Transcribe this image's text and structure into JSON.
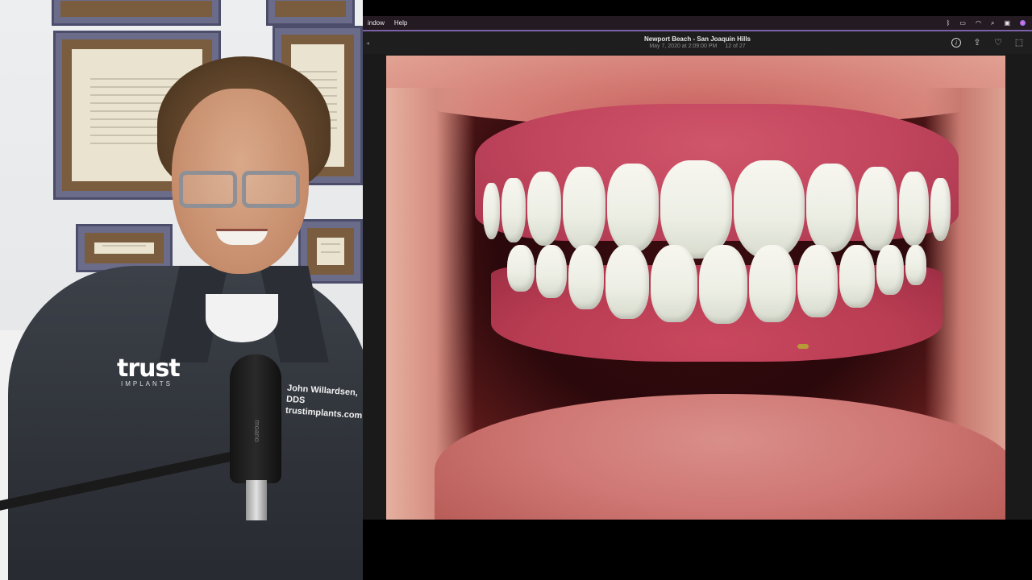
{
  "camera": {
    "logo_text": "trust",
    "logo_subtext": "IMPLANTS",
    "embroidery_line1": "John Willardsen, DDS",
    "embroidery_line2": "trustimplants.com",
    "mic_label": "moano"
  },
  "menubar": {
    "items": [
      "indow",
      "Help"
    ],
    "status_icons": [
      "bluetooth-icon",
      "battery-icon",
      "wifi-icon",
      "search-icon",
      "control-center-icon",
      "siri-icon"
    ]
  },
  "photos": {
    "title": "Newport Beach - San Joaquin Hills",
    "date": "May 7, 2020 at 2:09:00 PM",
    "position": "12 of 27",
    "toolbar_icons": [
      "info-icon",
      "share-icon",
      "favorite-heart-icon",
      "rotate-icon"
    ]
  },
  "colors": {
    "menubar_bg": "#241b22",
    "toolbar_bg": "#1e1e1e",
    "accent_line": "#7b62a8"
  }
}
